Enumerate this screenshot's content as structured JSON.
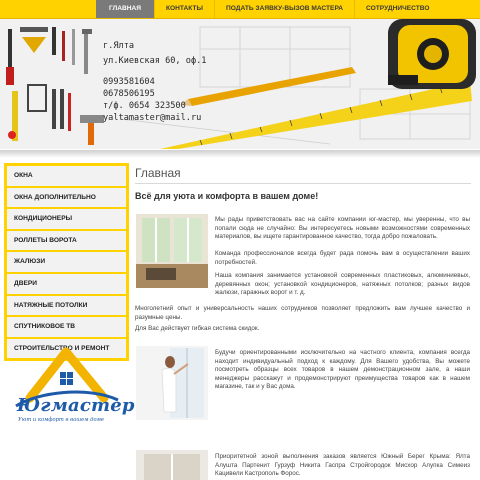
{
  "nav": {
    "items": [
      "ГЛАВНАЯ",
      "КОНТАКТЫ",
      "ПОДАТЬ ЗАЯВКУ-ВЫЗОВ МАСТЕРА",
      "СОТРУДНИЧЕСТВО"
    ],
    "active": 0
  },
  "contact": {
    "city": "г.Ялта",
    "address": "ул.Киевская 60, оф.1",
    "phone1": "0993581604",
    "phone2": "0678506195",
    "phone3": "т/ф. 0654 323500",
    "email": "yaltamaster@mail.ru"
  },
  "sidebar": {
    "items": [
      {
        "label": "ОКНА"
      },
      {
        "label": "ОКНА ДОПОЛНИТЕЛЬНО"
      },
      {
        "label": "КОНДИЦИОНЕРЫ"
      },
      {
        "label": "РОЛЛЕТЫ ВОРОТА"
      },
      {
        "label": "ЖАЛЮЗИ"
      },
      {
        "label": "ДВЕРИ"
      },
      {
        "label": "НАТЯЖНЫЕ ПОТОЛКИ"
      },
      {
        "label": "СПУТНИКОВОЕ ТВ"
      },
      {
        "label": "СТРОИТЕЛЬСТВО И РЕМОНТ"
      }
    ]
  },
  "logo": {
    "name": "Югмастер",
    "tagline": "Уют и комфорт в вашем доме"
  },
  "main": {
    "title": "Главная",
    "subtitle": "Всё для уюта и комфорта в вашем доме!",
    "p1a": "Мы рады приветствовать вас на сайте компании юг-мастер, мы уверенны, что вы попали сюда не случайно: Вы интересуетесь новыми возможностями современных материалов, вы ищете гарантированное качество, тогда добро пожаловать.",
    "p1b": "Команда профессионалов всегда будет рада помочь вам в осуществлении ваших потребностей.",
    "p2": "Наша компания занимается установкой современных пластиковых, алюминиевых, деревянных окон; установкой кондиционеров, натяжных потолков; разных видов жалюзи, гаражных ворот и т. д.",
    "p3": "Многолетний опыт и универсальность наших сотрудников позволяет предложить вам лучшее качество и разумные цены.",
    "p4": "Для Вас действует гибкая система скидок.",
    "p5": "Будучи ориентированными исключительно на частного клиента, компания всегда находит индивидуальный подход к каждому. Для Вашего удобства, Вы можете посмотреть образцы всех товаров в нашем демонстрационном зале, а наши менеджеры расскажут и продемонстрируют преимущества товаров как в нашем магазине, так и у Вас дома.",
    "p6": "Приоритетной зоной выполнения заказов является Южный Берег Крыма: Ялта Алушта Партенит Гурзуф Никита Гаспра Стройгородок Мисхор Алупка Симеиз Кацивели Кастрополь Форос."
  }
}
